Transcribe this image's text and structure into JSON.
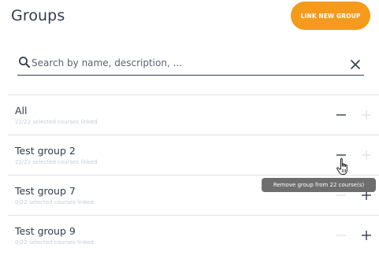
{
  "header": {
    "title": "Groups",
    "link_button_label": "LINK NEW GROUP"
  },
  "search": {
    "placeholder": "Search by name, description, ...",
    "value": ""
  },
  "groups": [
    {
      "name": "All",
      "subtitle": "22/22 selected courses linked",
      "can_remove": true,
      "can_add": false
    },
    {
      "name": "Test group 2",
      "subtitle": "22/22 selected courses linked",
      "can_remove": true,
      "can_add": false
    },
    {
      "name": "Test group 7",
      "subtitle": "0/22 selected courses linked",
      "can_remove": false,
      "can_add": true
    },
    {
      "name": "Test group 9",
      "subtitle": "0/22 selected courses linked",
      "can_remove": false,
      "can_add": true
    }
  ],
  "tooltip": {
    "text": "Remove group from 22 course(s)"
  },
  "colors": {
    "accent": "#f59a1b",
    "text": "#2f3d4e",
    "subtitle": "#c6ced6",
    "divider": "#dde2e7",
    "disabled_icon": "#dce1e6",
    "tooltip_bg": "#6e6e6e"
  },
  "icons": {
    "search": "search-icon",
    "clear": "close-icon",
    "remove": "minus-icon",
    "add": "plus-icon",
    "cursor": "hand-pointer-icon"
  }
}
